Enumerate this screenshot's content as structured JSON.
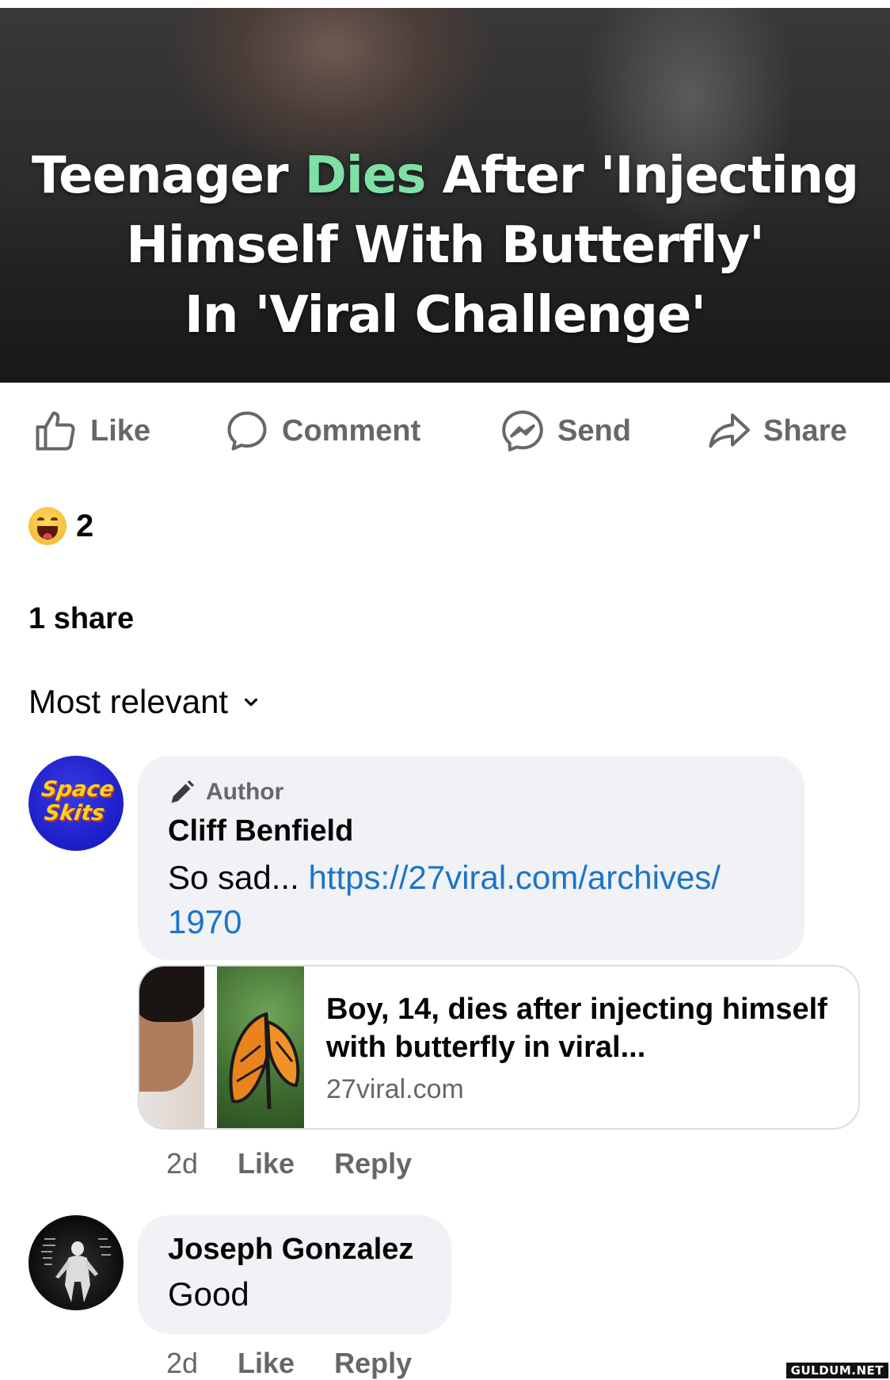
{
  "post": {
    "image_title": {
      "part1": "Teenager ",
      "highlight": "Dies",
      "part2": " After 'Injecting",
      "line2": "Himself With Butterfly'",
      "line3": "In 'Viral Challenge'"
    }
  },
  "actions": {
    "like": "Like",
    "comment": "Comment",
    "send": "Send",
    "share": "Share"
  },
  "reactions": {
    "emoji": "haha-emoji-icon",
    "count": "2"
  },
  "shares_text": "1 share",
  "sort": {
    "label": "Most relevant"
  },
  "comments": [
    {
      "badge": "Author",
      "avatar_text": "Space Skits",
      "name": "Cliff Benfield",
      "text": "So sad... ",
      "link_line1": "https://27viral.com/archives/",
      "link_line2": "1970",
      "card": {
        "title": "Boy, 14, dies after injecting himself with butterfly in viral...",
        "domain": "27viral.com"
      },
      "time": "2d",
      "like": "Like",
      "reply": "Reply"
    },
    {
      "name": "Joseph Gonzalez",
      "text": "Good",
      "time": "2d",
      "like": "Like",
      "reply": "Reply"
    }
  ],
  "watermark": "GULDUM.NET",
  "colors": {
    "accent_link": "#1b74c9",
    "highlight_green": "#7fe0a5",
    "muted": "#65676b",
    "bubble": "#f0f2f5"
  }
}
